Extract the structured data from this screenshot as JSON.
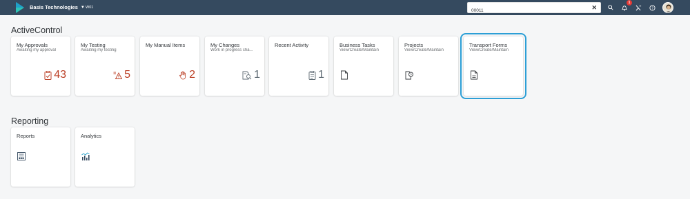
{
  "shell": {
    "company": "Basis Technologies",
    "system_id": "W01",
    "search_value": "00011",
    "notification_count": "1",
    "colors": {
      "bar": "#354a5f",
      "accent": "#2c9fd6",
      "kpi_red": "#bb3e24"
    }
  },
  "groups": [
    {
      "title": "ActiveControl",
      "tiles": [
        {
          "title": "My Approvals",
          "subtitle": "Awaiting my approval",
          "number": "43",
          "icon": "check-clipboard-icon",
          "color": "red"
        },
        {
          "title": "My Testing",
          "subtitle": "Awaiting my testing",
          "number": "5",
          "icon": "warning-list-icon",
          "color": "red"
        },
        {
          "title": "My Manual Items",
          "subtitle": "",
          "number": "2",
          "icon": "hand-icon",
          "color": "red"
        },
        {
          "title": "My Changes",
          "subtitle": "Work in progress cha...",
          "number": "1",
          "icon": "document-search-icon",
          "color": "gray"
        },
        {
          "title": "Recent Activity",
          "subtitle": "",
          "number": "1",
          "icon": "clipboard-icon",
          "color": "gray"
        },
        {
          "title": "Business Tasks",
          "subtitle": "View/Create/Maintain",
          "number": "",
          "icon": "blank-document-icon"
        },
        {
          "title": "Projects",
          "subtitle": "View/Create/Maintain",
          "number": "",
          "icon": "project-document-icon"
        },
        {
          "title": "Transport Forms",
          "subtitle": "View/Create/Maintain",
          "number": "",
          "icon": "form-document-icon"
        }
      ]
    },
    {
      "title": "Reporting",
      "tiles": [
        {
          "title": "Reports",
          "subtitle": "",
          "number": "",
          "icon": "report-icon"
        },
        {
          "title": "Analytics",
          "subtitle": "",
          "number": "",
          "icon": "analytics-icon"
        }
      ]
    }
  ]
}
